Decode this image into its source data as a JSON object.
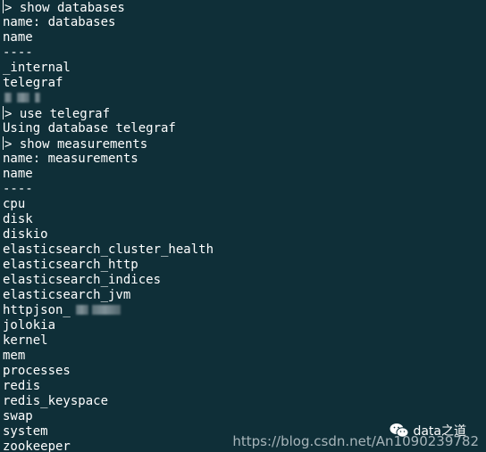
{
  "terminal": {
    "lines": [
      {
        "text": "> show databases"
      },
      {
        "text": "name: databases"
      },
      {
        "text": "name"
      },
      {
        "text": "----"
      },
      {
        "text": "_internal"
      },
      {
        "text": "telegraf"
      },
      {
        "text": "",
        "redacted": true
      },
      {
        "text": "> use telegraf"
      },
      {
        "text": "Using database telegraf"
      },
      {
        "text": "> show measurements"
      },
      {
        "text": "name: measurements"
      },
      {
        "text": "name"
      },
      {
        "text": "----"
      },
      {
        "text": "cpu"
      },
      {
        "text": "disk"
      },
      {
        "text": "diskio"
      },
      {
        "text": "elasticsearch_cluster_health"
      },
      {
        "text": "elasticsearch_http"
      },
      {
        "text": "elasticsearch_indices"
      },
      {
        "text": "elasticsearch_jvm"
      },
      {
        "text": "httpjson_",
        "redacted": true
      },
      {
        "text": "jolokia"
      },
      {
        "text": "kernel"
      },
      {
        "text": "mem"
      },
      {
        "text": "processes"
      },
      {
        "text": "redis"
      },
      {
        "text": "redis_keyspace"
      },
      {
        "text": "swap"
      },
      {
        "text": "system"
      },
      {
        "text": "zookeeper"
      }
    ]
  },
  "watermark": {
    "url": "https://blog.csdn.net/An1090239782",
    "badge_text": "data之道",
    "icon": "wechat-icon"
  },
  "colors": {
    "background": "#0f2f38",
    "text": "#ffffff"
  }
}
